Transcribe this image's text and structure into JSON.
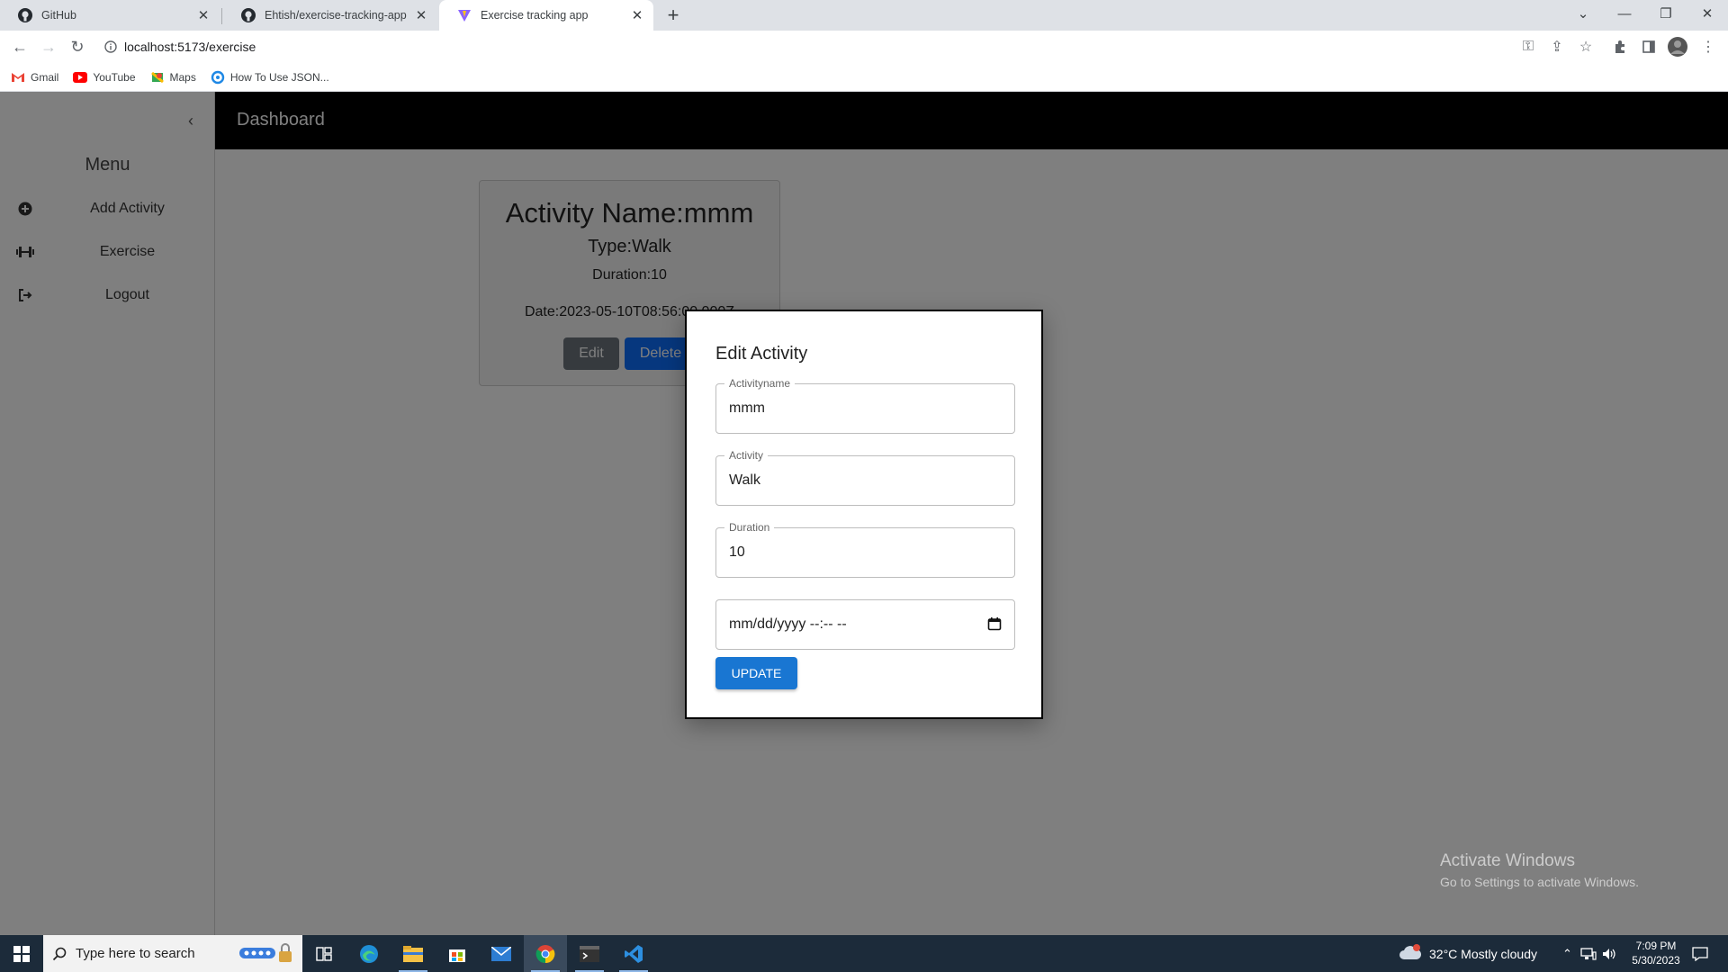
{
  "browser": {
    "tabs": [
      {
        "title": "GitHub",
        "icon": "github-icon",
        "active": false
      },
      {
        "title": "Ehtish/exercise-tracking-app",
        "icon": "github-icon",
        "active": false
      },
      {
        "title": "Exercise tracking app",
        "icon": "vite-icon",
        "active": true
      }
    ],
    "url": "localhost:5173/exercise",
    "bookmarks": [
      {
        "label": "Gmail",
        "icon": "gmail-icon"
      },
      {
        "label": "YouTube",
        "icon": "youtube-icon"
      },
      {
        "label": "Maps",
        "icon": "maps-icon"
      },
      {
        "label": "How To Use JSON...",
        "icon": "json-site-icon"
      }
    ]
  },
  "sidebar": {
    "title": "Menu",
    "items": [
      {
        "label": "Add Activity",
        "icon": "plus-circle-icon"
      },
      {
        "label": "Exercise",
        "icon": "dumbbell-icon"
      },
      {
        "label": "Logout",
        "icon": "logout-icon"
      }
    ]
  },
  "header": {
    "title": "Dashboard"
  },
  "card": {
    "name": "Activity Name:mmm",
    "type": "Type:Walk",
    "duration": "Duration:10",
    "date": "Date:2023-05-10T08:56:00.000Z",
    "edit_label": "Edit",
    "delete_label": "Delete"
  },
  "modal": {
    "title": "Edit Activity",
    "fields": [
      {
        "label": "Activityname",
        "value": "mmm"
      },
      {
        "label": "Activity",
        "value": "Walk"
      },
      {
        "label": "Duration",
        "value": "10"
      },
      {
        "label": "",
        "value": "mm/dd/yyyy --:-- --"
      }
    ],
    "update_label": "UPDATE"
  },
  "watermark": {
    "line1": "Activate Windows",
    "line2": "Go to Settings to activate Windows."
  },
  "taskbar": {
    "search_placeholder": "Type here to search",
    "weather": "32°C  Mostly cloudy",
    "time": "7:09 PM",
    "date": "5/30/2023"
  },
  "colors": {
    "header_bg": "#000000",
    "primary_button": "#0d6efd",
    "update_button": "#1976d2",
    "secondary_button": "#6c757d"
  }
}
